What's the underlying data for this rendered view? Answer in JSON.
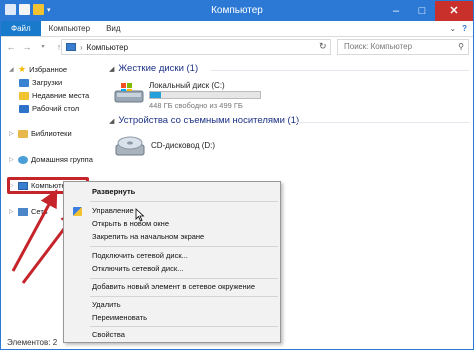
{
  "window": {
    "title": "Компьютер"
  },
  "tabs": {
    "file": "Файл",
    "computer": "Компьютер",
    "view": "Вид"
  },
  "address": {
    "path": "Компьютер"
  },
  "search": {
    "placeholder": "Поиск: Компьютер"
  },
  "nav": {
    "favorites": "Избранное",
    "downloads": "Загрузки",
    "recent": "Недавние места",
    "desktop": "Рабочий стол",
    "libraries": "Библиотеки",
    "homegroup": "Домашняя группа",
    "computer": "Компьютер",
    "network": "Сеть"
  },
  "content": {
    "hard_disks_header": "Жесткие диски (1)",
    "local_disk_name": "Локальный диск (C:)",
    "local_disk_free": "448 ГБ свободно из 499 ГБ",
    "local_disk_used_fraction": 0.1,
    "removable_header": "Устройства со съемными носителями (1)",
    "cd_drive_name": "CD-дисковод (D:)"
  },
  "context_menu": {
    "expand": "Развернуть",
    "manage": "Управление",
    "open_new_window": "Открыть в новом окне",
    "pin_start": "Закрепить на начальном экране",
    "map_drive": "Подключить сетевой диск...",
    "disconnect_drive": "Отключить сетевой диск...",
    "add_network_location": "Добавить новый элемент в сетевое окружение",
    "delete": "Удалить",
    "rename": "Переименовать",
    "properties": "Свойства"
  },
  "status": {
    "items": "Элементов: 2"
  },
  "colors": {
    "accent": "#2b79d5",
    "highlight": "#c5242a"
  }
}
